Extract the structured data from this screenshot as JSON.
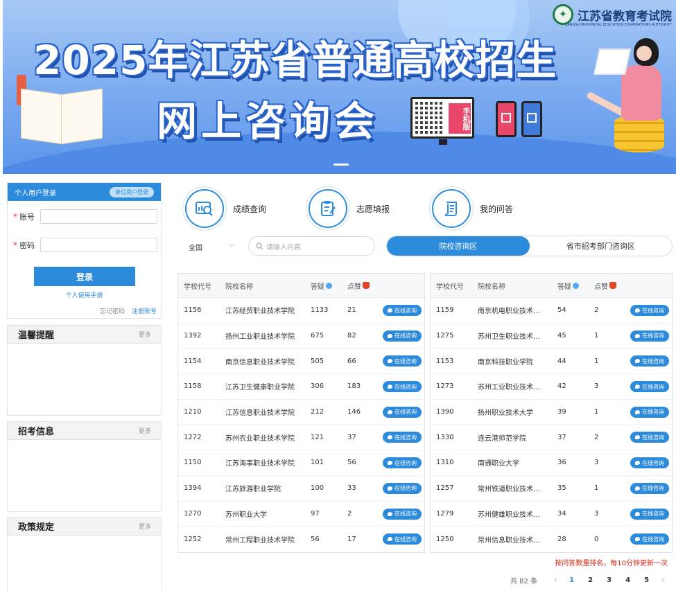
{
  "banner": {
    "title_line1": "2025年江苏省普通高校招生",
    "title_line2": "网上咨询会",
    "org_name": "江苏省教育考试院",
    "org_sub": "JIANGSU PROVINCIAL EDUCATION EXAMINATIONS AUTHORITY",
    "mobile_label": "手机版"
  },
  "login": {
    "header": "个人用户登录",
    "org_login": "单位用户登录",
    "account_label": "账号",
    "password_label": "密码",
    "login_button": "登录",
    "manual_link": "个人使用手册",
    "forgot_link": "忘记密码",
    "register_link": "注册账号"
  },
  "panels": [
    {
      "title": "温馨提醒",
      "more": "更多"
    },
    {
      "title": "招考信息",
      "more": "更多"
    },
    {
      "title": "政策规定",
      "more": "更多"
    }
  ],
  "quick_links": [
    {
      "label": "成绩查询",
      "icon": "chart-search-icon"
    },
    {
      "label": "志愿填报",
      "icon": "clipboard-edit-icon"
    },
    {
      "label": "我的问答",
      "icon": "scroll-icon"
    }
  ],
  "filter": {
    "region_value": "全国",
    "search_placeholder": "请输入内容"
  },
  "tabs": [
    {
      "label": "院校咨询区",
      "active": true
    },
    {
      "label": "省市招考部门咨询区",
      "active": false
    }
  ],
  "table_headers": {
    "code": "学校代号",
    "name": "院校名称",
    "questions": "答疑",
    "likes": "点赞"
  },
  "consult_label": "在线咨询",
  "left_table": [
    {
      "code": "1156",
      "name": "江苏经贸职业技术学院",
      "questions": "1133",
      "likes": "21"
    },
    {
      "code": "1392",
      "name": "扬州工业职业技术学院",
      "questions": "675",
      "likes": "82"
    },
    {
      "code": "1154",
      "name": "南京信息职业技术学院",
      "questions": "505",
      "likes": "66"
    },
    {
      "code": "1158",
      "name": "江苏卫生健康职业学院",
      "questions": "306",
      "likes": "183"
    },
    {
      "code": "1210",
      "name": "江苏信息职业技术学院",
      "questions": "212",
      "likes": "146"
    },
    {
      "code": "1272",
      "name": "苏州农业职业技术学院",
      "questions": "121",
      "likes": "37"
    },
    {
      "code": "1150",
      "name": "江苏海事职业技术学院",
      "questions": "101",
      "likes": "56"
    },
    {
      "code": "1394",
      "name": "江苏旅游职业学院",
      "questions": "100",
      "likes": "33"
    },
    {
      "code": "1270",
      "name": "苏州职业大学",
      "questions": "97",
      "likes": "2"
    },
    {
      "code": "1252",
      "name": "常州工程职业技术学院",
      "questions": "56",
      "likes": "17"
    }
  ],
  "right_table": [
    {
      "code": "1159",
      "name": "南京机电职业技术…",
      "questions": "54",
      "likes": "2"
    },
    {
      "code": "1275",
      "name": "苏州卫生职业技术…",
      "questions": "45",
      "likes": "1"
    },
    {
      "code": "1153",
      "name": "南京科技职业学院",
      "questions": "44",
      "likes": "1"
    },
    {
      "code": "1273",
      "name": "苏州工业职业技术…",
      "questions": "42",
      "likes": "3"
    },
    {
      "code": "1390",
      "name": "扬州职业技术大学",
      "questions": "39",
      "likes": "1"
    },
    {
      "code": "1330",
      "name": "连云港师范学院",
      "questions": "37",
      "likes": "2"
    },
    {
      "code": "1310",
      "name": "南通职业大学",
      "questions": "36",
      "likes": "3"
    },
    {
      "code": "1257",
      "name": "常州铁道职业技术…",
      "questions": "35",
      "likes": "1"
    },
    {
      "code": "1279",
      "name": "苏州健雄职业技术…",
      "questions": "34",
      "likes": "3"
    },
    {
      "code": "1250",
      "name": "常州信息职业技术…",
      "questions": "28",
      "likes": "0"
    }
  ],
  "ranking_note": "按问答数量排名，每10分钟更新一次",
  "pagination": {
    "total": "共 82 条",
    "pages": [
      "1",
      "2",
      "3",
      "4",
      "5"
    ],
    "current": "1",
    "prev": "‹",
    "next": "›"
  },
  "colors": {
    "primary": "#2d8bdc",
    "note_red": "#d9230f"
  }
}
